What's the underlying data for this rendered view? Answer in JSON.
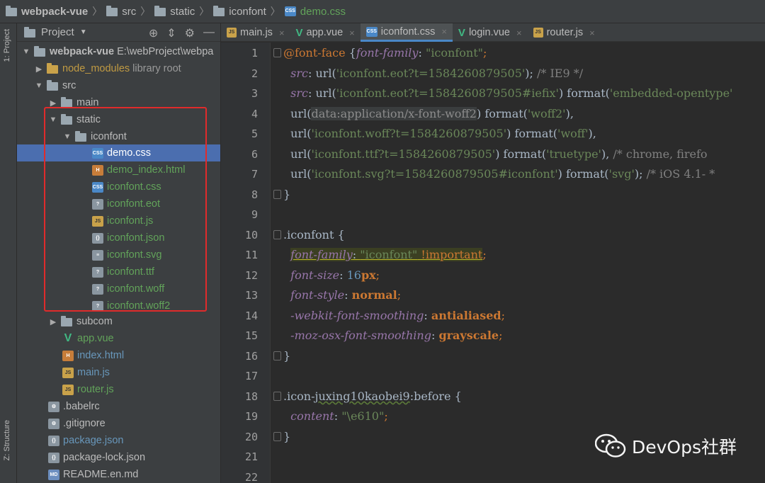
{
  "breadcrumb": [
    "webpack-vue",
    "src",
    "static",
    "iconfont",
    "demo.css"
  ],
  "sidebar_strip": {
    "project_tab": "1: Project",
    "structure_tab": "Z: Structure"
  },
  "panel": {
    "title": "Project",
    "root_name": "webpack-vue",
    "root_path": "E:\\webProject\\webpa",
    "node_modules": "node_modules",
    "library_root": "library root",
    "src": "src",
    "main": "main",
    "static": "static",
    "iconfont": "iconfont",
    "files": [
      "demo.css",
      "demo_index.html",
      "iconfont.css",
      "iconfont.eot",
      "iconfont.js",
      "iconfont.json",
      "iconfont.svg",
      "iconfont.ttf",
      "iconfont.woff",
      "iconfont.woff2"
    ],
    "subcom": "subcom",
    "src_files": [
      "app.vue",
      "index.html",
      "main.js",
      "router.js"
    ],
    "root_files": [
      ".babelrc",
      ".gitignore",
      "package.json",
      "package-lock.json",
      "README.en.md"
    ]
  },
  "tabs": [
    "main.js",
    "app.vue",
    "iconfont.css",
    "login.vue",
    "router.js"
  ],
  "line_numbers": [
    "1",
    "2",
    "3",
    "4",
    "5",
    "6",
    "7",
    "8",
    "9",
    "10",
    "11",
    "12",
    "13",
    "14",
    "15",
    "16",
    "17",
    "18",
    "19",
    "20",
    "21",
    "22"
  ],
  "code": {
    "l1": [
      "@font-face",
      " {",
      "font-family",
      ": ",
      "\"iconfont\"",
      ";"
    ],
    "l2": [
      "  ",
      "src",
      ": url(",
      "'iconfont.eot?t=1584260879505'",
      "); ",
      "/* IE9 */"
    ],
    "l3": [
      "  ",
      "src",
      ": url(",
      "'iconfont.eot?t=1584260879505#iefix'",
      ") ",
      "format",
      "(",
      "'embedded-opentype'"
    ],
    "l4": [
      "  url(",
      "data:application/x-font-woff2",
      ") ",
      "format",
      "(",
      "'woff2'",
      "),"
    ],
    "l5": [
      "  url(",
      "'iconfont.woff?t=1584260879505'",
      ") ",
      "format",
      "(",
      "'woff'",
      "),"
    ],
    "l6": [
      "  url(",
      "'iconfont.ttf?t=1584260879505'",
      ") ",
      "format",
      "(",
      "'truetype'",
      "), ",
      "/* chrome, firefo"
    ],
    "l7": [
      "  url(",
      "'iconfont.svg?t=1584260879505#iconfont'",
      ") ",
      "format",
      "(",
      "'svg'",
      "); ",
      "/* iOS 4.1- *"
    ],
    "l8": "}",
    "l10": [
      ".iconfont",
      " {"
    ],
    "l11": [
      "  ",
      "font-family",
      ": ",
      "\"iconfont\"",
      " !important",
      ";"
    ],
    "l12": [
      "  ",
      "font-size",
      ": ",
      "16",
      "px",
      ";"
    ],
    "l13": [
      "  ",
      "font-style",
      ": ",
      "normal",
      ";"
    ],
    "l14": [
      "  ",
      "-webkit-font-smoothing",
      ": ",
      "antialiased",
      ";"
    ],
    "l15": [
      "  ",
      "-moz-osx-font-smoothing",
      ": ",
      "grayscale",
      ";"
    ],
    "l16": "}",
    "l18": [
      ".icon-",
      "juxing10kaobei9",
      ":before {"
    ],
    "l19": [
      "  ",
      "content",
      ": ",
      "\"\\e610\"",
      ";"
    ],
    "l20": "}"
  },
  "watermark": "DevOps社群",
  "colors": {
    "selection": "#4b6eaf",
    "highlight_box": "#e02b2b",
    "accent": "#4a88c7"
  }
}
